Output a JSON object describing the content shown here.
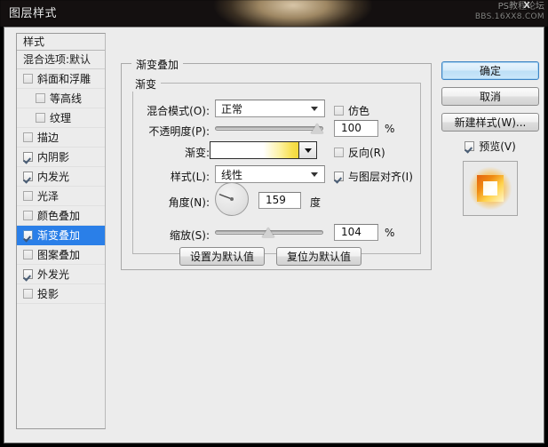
{
  "window": {
    "title": "图层样式",
    "watermark_line1": "PS教程论坛",
    "watermark_line2": "BBS.16XX8.COM",
    "close_glyph": "X"
  },
  "styles_panel": {
    "header": "样式",
    "blending_options": "混合选项:默认",
    "items": [
      {
        "label": "斜面和浮雕",
        "checked": false,
        "indent": false,
        "selected": false
      },
      {
        "label": "等高线",
        "checked": false,
        "indent": true,
        "selected": false
      },
      {
        "label": "纹理",
        "checked": false,
        "indent": true,
        "selected": false
      },
      {
        "label": "描边",
        "checked": false,
        "indent": false,
        "selected": false
      },
      {
        "label": "内阴影",
        "checked": true,
        "indent": false,
        "selected": false
      },
      {
        "label": "内发光",
        "checked": true,
        "indent": false,
        "selected": false
      },
      {
        "label": "光泽",
        "checked": false,
        "indent": false,
        "selected": false
      },
      {
        "label": "颜色叠加",
        "checked": false,
        "indent": false,
        "selected": false
      },
      {
        "label": "渐变叠加",
        "checked": true,
        "indent": false,
        "selected": true
      },
      {
        "label": "图案叠加",
        "checked": false,
        "indent": false,
        "selected": false
      },
      {
        "label": "外发光",
        "checked": true,
        "indent": false,
        "selected": false
      },
      {
        "label": "投影",
        "checked": false,
        "indent": false,
        "selected": false
      }
    ]
  },
  "gradient_overlay": {
    "section_title": "渐变叠加",
    "group_title": "渐变",
    "blend_mode": {
      "label": "混合模式(O):",
      "value": "正常"
    },
    "dither": {
      "label": "仿色",
      "checked": false
    },
    "opacity": {
      "label": "不透明度(P):",
      "value": "100",
      "unit": "%",
      "percent": 100
    },
    "gradient": {
      "label": "渐变:",
      "start_color": "#ffffff",
      "end_color": "#f7e04f"
    },
    "reverse": {
      "label": "反向(R)",
      "checked": false
    },
    "style": {
      "label": "样式(L):",
      "value": "线性"
    },
    "align_with_layer": {
      "label": "与图层对齐(I)",
      "checked": true
    },
    "angle": {
      "label": "角度(N):",
      "value": "159",
      "unit": "度",
      "degrees": 159
    },
    "scale": {
      "label": "缩放(S):",
      "value": "104",
      "unit": "%",
      "percent": 52
    }
  },
  "default_buttons": {
    "set_default": "设置为默认值",
    "reset_default": "复位为默认值"
  },
  "right_buttons": {
    "ok": "确定",
    "cancel": "取消",
    "new_style": "新建样式(W)...",
    "preview": {
      "label": "预览(V)",
      "checked": true
    }
  },
  "colors": {
    "selection_blue": "#2a7fe8",
    "dialog_bg": "#ececec",
    "gradient_yellow": "#f7e04f"
  }
}
